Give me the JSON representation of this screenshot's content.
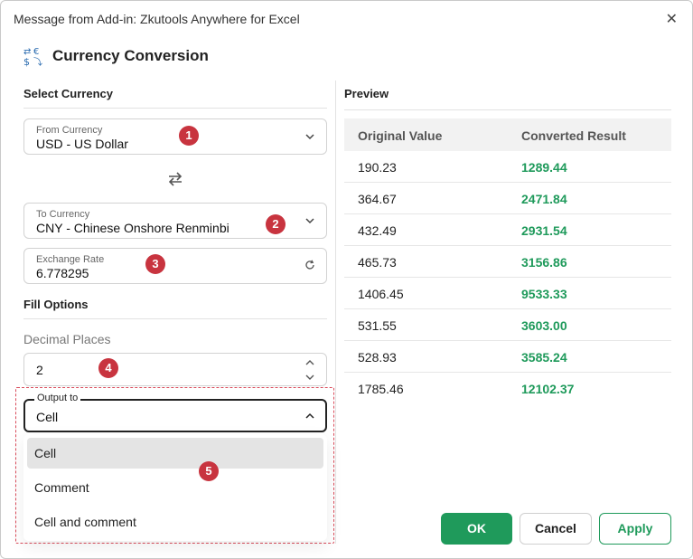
{
  "window": {
    "title": "Message from Add-in: Zkutools Anywhere for Excel",
    "close_icon": "close-icon"
  },
  "header": {
    "icon": "currency-exchange-icon",
    "title": "Currency Conversion"
  },
  "select_currency": {
    "title": "Select Currency",
    "from": {
      "label": "From Currency",
      "value": "USD - US Dollar"
    },
    "swap_icon": "swap-arrows-icon",
    "to": {
      "label": "To Currency",
      "value": "CNY - Chinese Onshore Renminbi"
    },
    "rate": {
      "label": "Exchange Rate",
      "value": "6.778295",
      "refresh_icon": "refresh-icon"
    }
  },
  "fill_options": {
    "title": "Fill Options",
    "decimal_label": "Decimal Places",
    "decimal_value": "2",
    "output": {
      "label": "Output to",
      "value": "Cell"
    },
    "menu": [
      "Cell",
      "Comment",
      "Cell and comment"
    ],
    "selected_index": 0
  },
  "badges": [
    "1",
    "2",
    "3",
    "4",
    "5"
  ],
  "preview": {
    "title": "Preview",
    "headers": [
      "Original Value",
      "Converted Result"
    ],
    "rows": [
      [
        "190.23",
        "1289.44"
      ],
      [
        "364.67",
        "2471.84"
      ],
      [
        "432.49",
        "2931.54"
      ],
      [
        "465.73",
        "3156.86"
      ],
      [
        "1406.45",
        "9533.33"
      ],
      [
        "531.55",
        "3603.00"
      ],
      [
        "528.93",
        "3585.24"
      ],
      [
        "1785.46",
        "12102.37"
      ]
    ]
  },
  "buttons": {
    "ok": "OK",
    "cancel": "Cancel",
    "apply": "Apply"
  },
  "colors": {
    "accent_green": "#1f9a5b",
    "badge_red": "#c8343f",
    "dashed_red": "#d94b5a"
  }
}
